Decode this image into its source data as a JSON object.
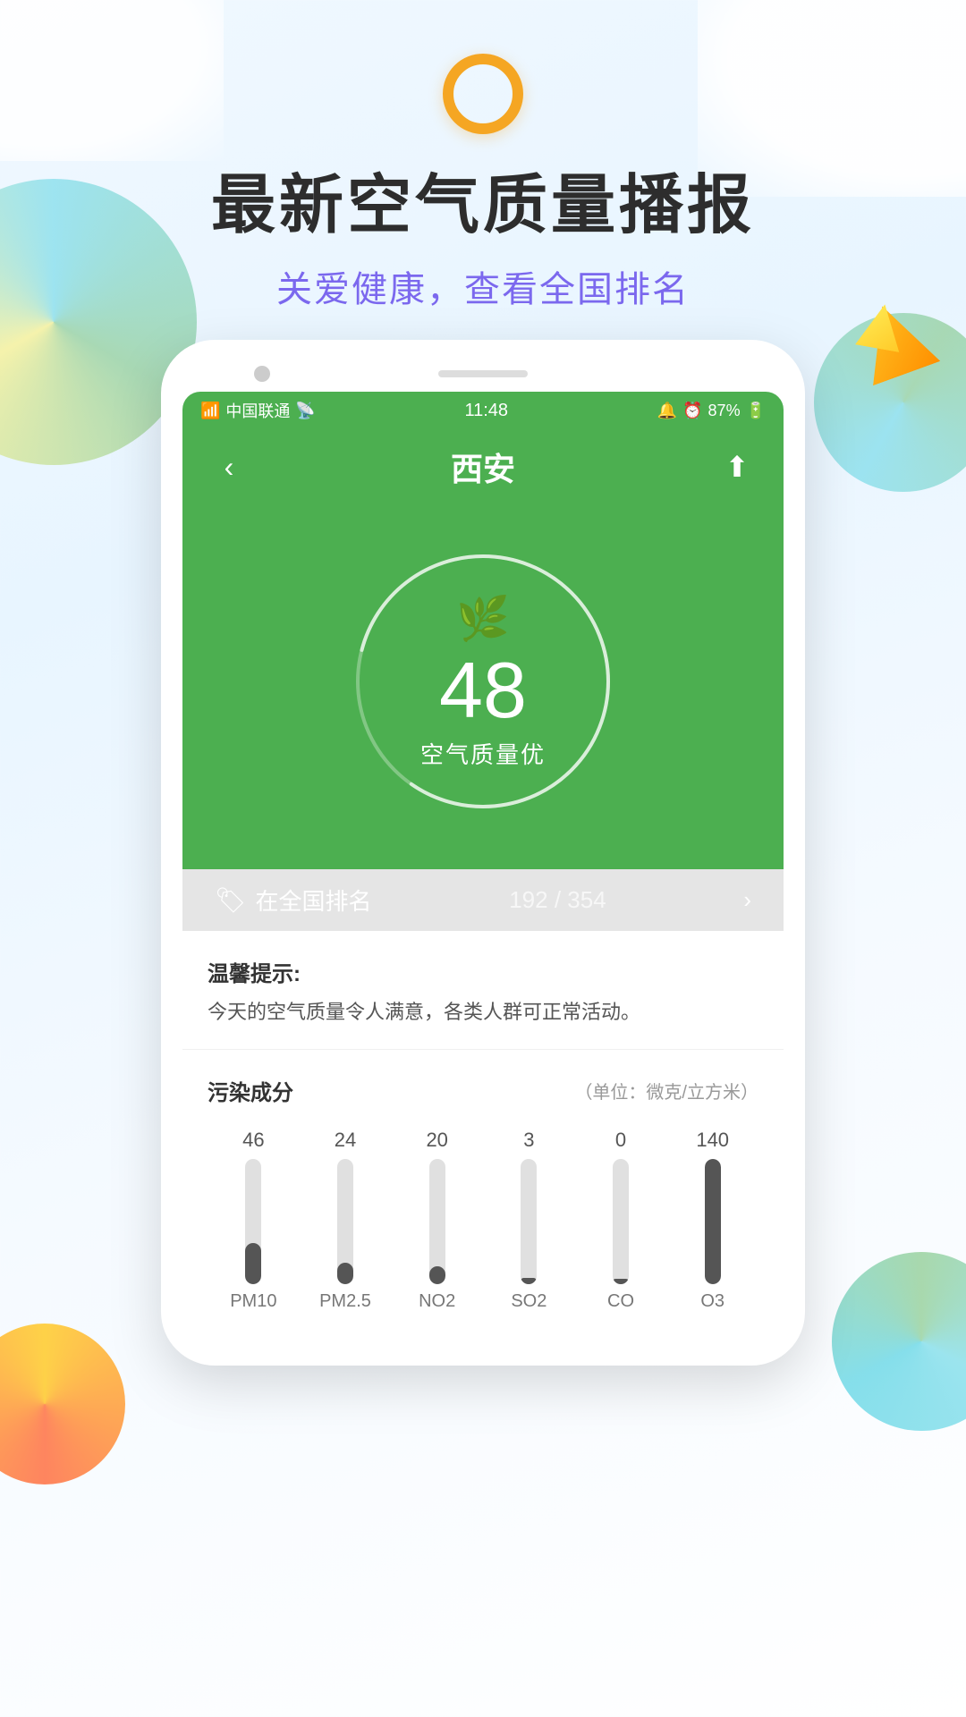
{
  "app": {
    "main_title": "最新空气质量播报",
    "sub_title": "关爱健康，查看全国排名"
  },
  "status_bar": {
    "carrier": "中国联通",
    "wifi": true,
    "time": "11:48",
    "battery": "87%"
  },
  "app_header": {
    "city": "西安",
    "back_label": "‹",
    "share_label": "⬆"
  },
  "aqi": {
    "value": "48",
    "label": "空气质量优",
    "leaf": "🌿"
  },
  "ranking": {
    "prefix": "在全国排名",
    "current": "192",
    "total": "354"
  },
  "tip": {
    "title": "温馨提示:",
    "content": "今天的空气质量令人满意，各类人群可正常活动。"
  },
  "pollution": {
    "title": "污染成分",
    "unit": "（单位：微克/立方米）",
    "items": [
      {
        "name": "PM10",
        "value": "46",
        "height_pct": 33
      },
      {
        "name": "PM2.5",
        "value": "24",
        "height_pct": 17
      },
      {
        "name": "NO2",
        "value": "20",
        "height_pct": 14
      },
      {
        "name": "SO2",
        "value": "3",
        "height_pct": 5
      },
      {
        "name": "CO",
        "value": "0",
        "height_pct": 3
      },
      {
        "name": "O3",
        "value": "140",
        "height_pct": 100
      }
    ],
    "max_value": "140"
  }
}
